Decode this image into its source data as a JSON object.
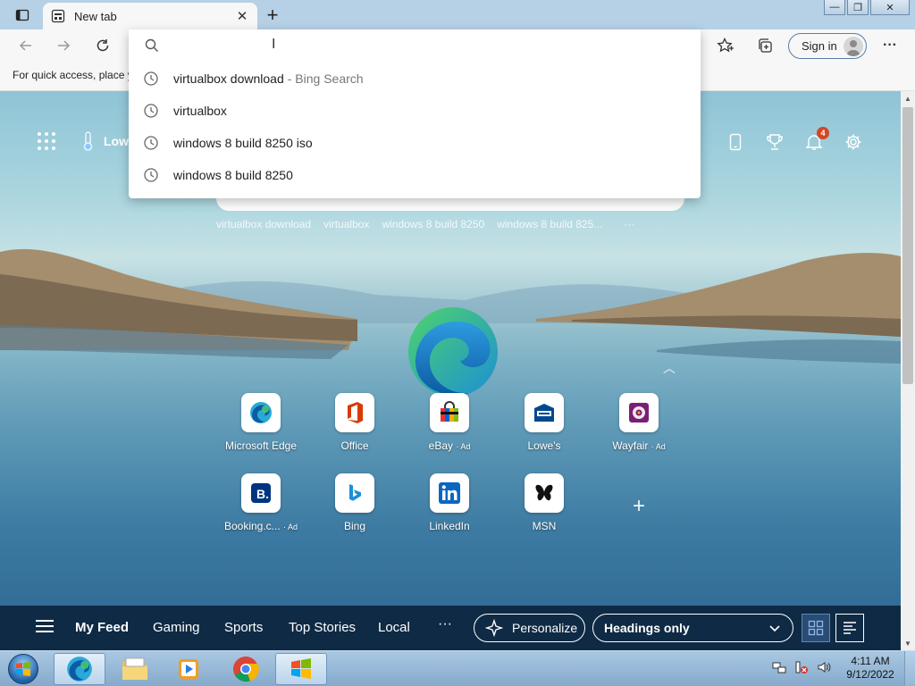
{
  "browser": {
    "tab": {
      "title": "New tab",
      "favicon": "newtab-icon",
      "close": "✕"
    },
    "new_tab_symbol": "+",
    "window_controls": {
      "minimize": "—",
      "restore": "❐",
      "close": "✕"
    },
    "toolbar": {
      "back": "back-icon",
      "forward": "forward-icon",
      "refresh": "refresh-icon",
      "favorites": "favorites-icon",
      "collections": "collections-icon",
      "sign_in_label": "Sign in",
      "more": "···"
    },
    "favorites_bar": {
      "message": "For quick access, place y"
    }
  },
  "address_dropdown": {
    "input_value": "",
    "suggestions": [
      {
        "text": "virtualbox download",
        "engine": "- Bing Search"
      },
      {
        "text": "virtualbox",
        "engine": ""
      },
      {
        "text": "windows 8 build 8250 iso",
        "engine": ""
      },
      {
        "text": "windows 8 build 8250",
        "engine": ""
      }
    ]
  },
  "ntp": {
    "weather": "Low",
    "notification_count": "4",
    "recent_searches": [
      "virtualbox download",
      "virtualbox",
      "windows 8 build 8250",
      "windows 8 build 825...",
      "···"
    ],
    "tiles": [
      {
        "label": "Microsoft Edge",
        "ad": ""
      },
      {
        "label": "Office",
        "ad": ""
      },
      {
        "label": "eBay",
        "ad": "· Ad"
      },
      {
        "label": "Lowe's",
        "ad": ""
      },
      {
        "label": "Wayfair",
        "ad": "· Ad"
      },
      {
        "label": "Booking.c...",
        "ad": "· Ad"
      },
      {
        "label": "Bing",
        "ad": ""
      },
      {
        "label": "LinkedIn",
        "ad": ""
      },
      {
        "label": "MSN",
        "ad": ""
      }
    ],
    "add_tile": "+",
    "feed": {
      "tabs": [
        "My Feed",
        "Gaming",
        "Sports",
        "Top Stories",
        "Local"
      ],
      "more": "···",
      "personalize": "Personalize",
      "layout_select": "Headings only"
    }
  },
  "taskbar": {
    "apps": [
      "edge-icon",
      "file-explorer-icon",
      "media-player-icon",
      "chrome-icon",
      "windows-update-icon"
    ],
    "clock_time": "4:11 AM",
    "clock_date": "9/12/2022"
  },
  "colors": {
    "feed_bar": "#0f2a44",
    "title_bar": "#b6d0e6",
    "notification_badge": "#d24726"
  }
}
